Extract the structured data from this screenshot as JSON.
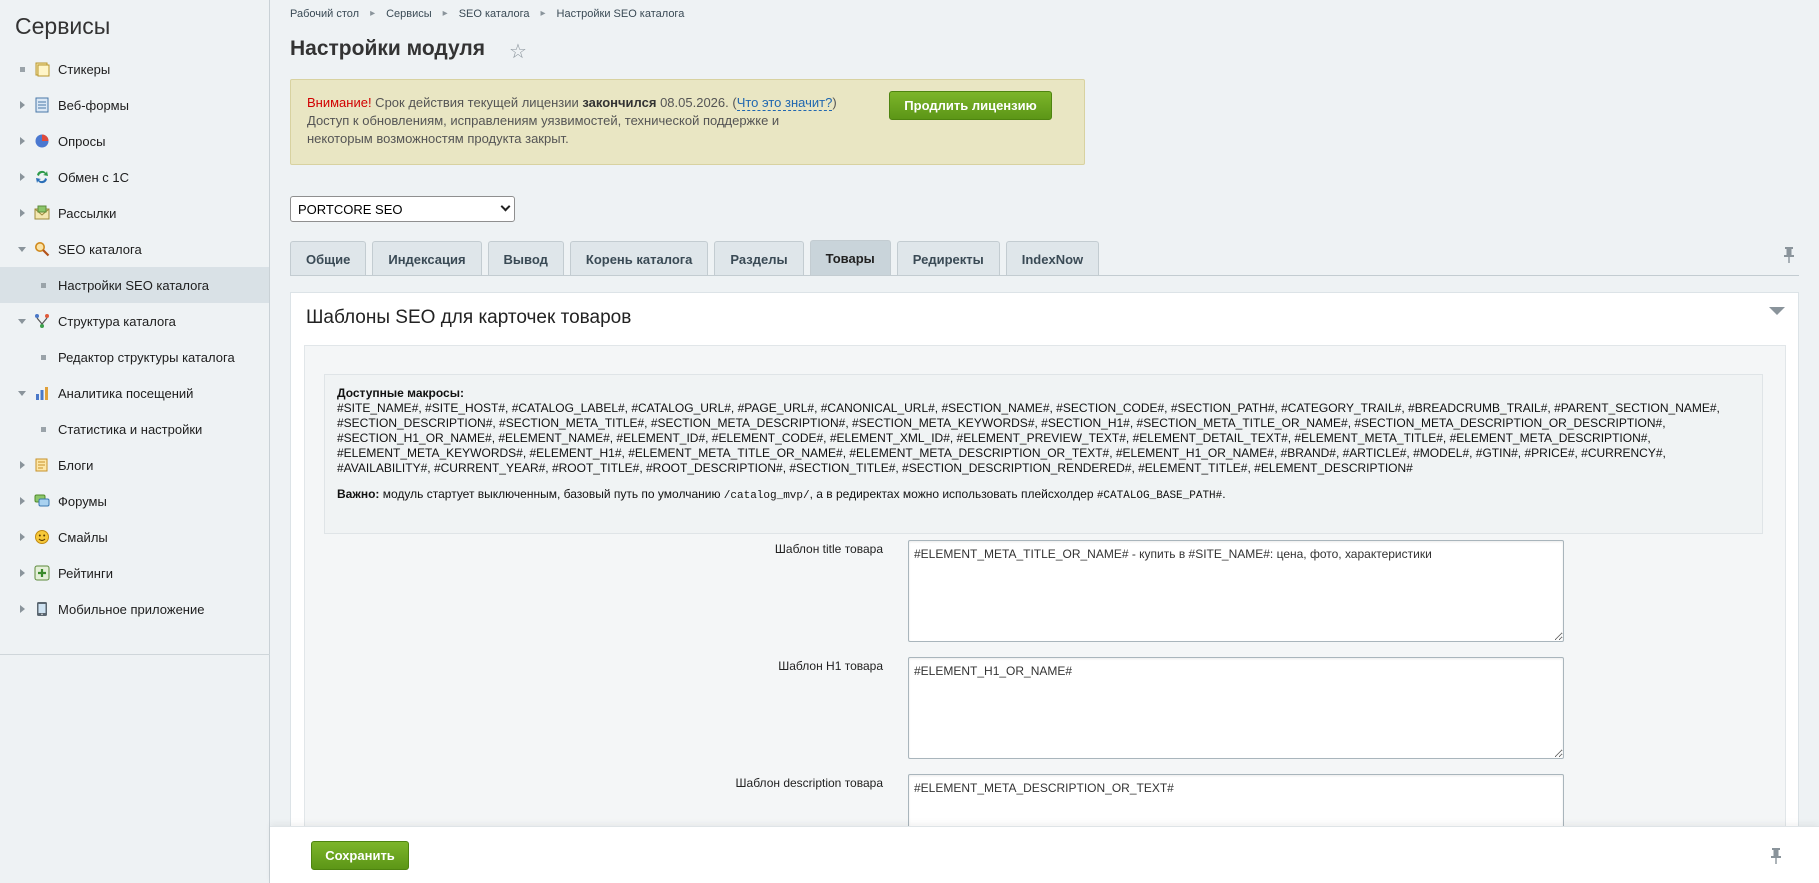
{
  "sidebar": {
    "title": "Сервисы",
    "items": [
      {
        "label": "Стикеры",
        "icon": "sticker-icon"
      },
      {
        "label": "Веб-формы",
        "icon": "webform-icon"
      },
      {
        "label": "Опросы",
        "icon": "poll-icon"
      },
      {
        "label": "Обмен с 1С",
        "icon": "exchange-icon"
      },
      {
        "label": "Рассылки",
        "icon": "mail-icon"
      },
      {
        "label": "SEO каталога",
        "icon": "seo-search-icon"
      },
      {
        "label": "Настройки SEO каталога"
      },
      {
        "label": "Структура каталога",
        "icon": "structure-icon"
      },
      {
        "label": "Редактор структуры каталога"
      },
      {
        "label": "Аналитика посещений",
        "icon": "analytics-icon"
      },
      {
        "label": "Статистика и настройки"
      },
      {
        "label": "Блоги",
        "icon": "blog-icon"
      },
      {
        "label": "Форумы",
        "icon": "forum-icon"
      },
      {
        "label": "Смайлы",
        "icon": "smile-icon"
      },
      {
        "label": "Рейтинги",
        "icon": "rating-icon"
      },
      {
        "label": "Мобильное приложение",
        "icon": "mobile-icon"
      }
    ]
  },
  "breadcrumb": [
    "Рабочий стол",
    "Сервисы",
    "SEO каталога",
    "Настройки SEO каталога"
  ],
  "page_title": "Настройки модуля",
  "license": {
    "warn": "Внимание!",
    "text1": " Срок действия текущей лицензии ",
    "expired": "закончился",
    "text2": " 08.05.2026. (",
    "link": "Что это значит?",
    "text3": ")",
    "line2": "Доступ к обновлениям, исправлениям уязвимостей, технической поддержке и",
    "line3": "некоторым возможностям продукта закрыт.",
    "button": "Продлить лицензию"
  },
  "module_select": {
    "value": "PORTCORE SEO"
  },
  "tabs": [
    "Общие",
    "Индексация",
    "Вывод",
    "Корень каталога",
    "Разделы",
    "Товары",
    "Редиректы",
    "IndexNow"
  ],
  "active_tab": "Товары",
  "panel": {
    "title": "Шаблоны SEO для карточек товаров",
    "macros_title": "Доступные макросы:",
    "macros_list": "#SITE_NAME#, #SITE_HOST#, #CATALOG_LABEL#, #CATALOG_URL#, #PAGE_URL#, #CANONICAL_URL#, #SECTION_NAME#, #SECTION_CODE#, #SECTION_PATH#, #CATEGORY_TRAIL#, #BREADCRUMB_TRAIL#, #PARENT_SECTION_NAME#, #SECTION_DESCRIPTION#, #SECTION_META_TITLE#, #SECTION_META_DESCRIPTION#, #SECTION_META_KEYWORDS#, #SECTION_H1#, #SECTION_META_TITLE_OR_NAME#, #SECTION_META_DESCRIPTION_OR_DESCRIPTION#, #SECTION_H1_OR_NAME#, #ELEMENT_NAME#, #ELEMENT_ID#, #ELEMENT_CODE#, #ELEMENT_XML_ID#, #ELEMENT_PREVIEW_TEXT#, #ELEMENT_DETAIL_TEXT#, #ELEMENT_META_TITLE#, #ELEMENT_META_DESCRIPTION#, #ELEMENT_META_KEYWORDS#, #ELEMENT_H1#, #ELEMENT_META_TITLE_OR_NAME#, #ELEMENT_META_DESCRIPTION_OR_TEXT#, #ELEMENT_H1_OR_NAME#, #BRAND#, #ARTICLE#, #MODEL#, #GTIN#, #PRICE#, #CURRENCY#, #AVAILABILITY#, #CURRENT_YEAR#, #ROOT_TITLE#, #ROOT_DESCRIPTION#, #SECTION_TITLE#, #SECTION_DESCRIPTION_RENDERED#, #ELEMENT_TITLE#, #ELEMENT_DESCRIPTION#",
    "important_label": "Важно:",
    "important_text1": " модуль стартует выключенным, базовый путь по умолчанию ",
    "important_code1": "/catalog_mvp/",
    "important_text2": ", а в редиректах можно использовать плейсхолдер ",
    "important_code2": "#CATALOG_BASE_PATH#",
    "important_text3": ".",
    "fields": [
      {
        "label": "Шаблон title товара",
        "value": "#ELEMENT_META_TITLE_OR_NAME# - купить в #SITE_NAME#: цена, фото, характеристики"
      },
      {
        "label": "Шаблон H1 товара",
        "value": "#ELEMENT_H1_OR_NAME#"
      },
      {
        "label": "Шаблон description товара",
        "value": "#ELEMENT_META_DESCRIPTION_OR_TEXT#"
      }
    ]
  },
  "footer": {
    "save": "Сохранить"
  }
}
